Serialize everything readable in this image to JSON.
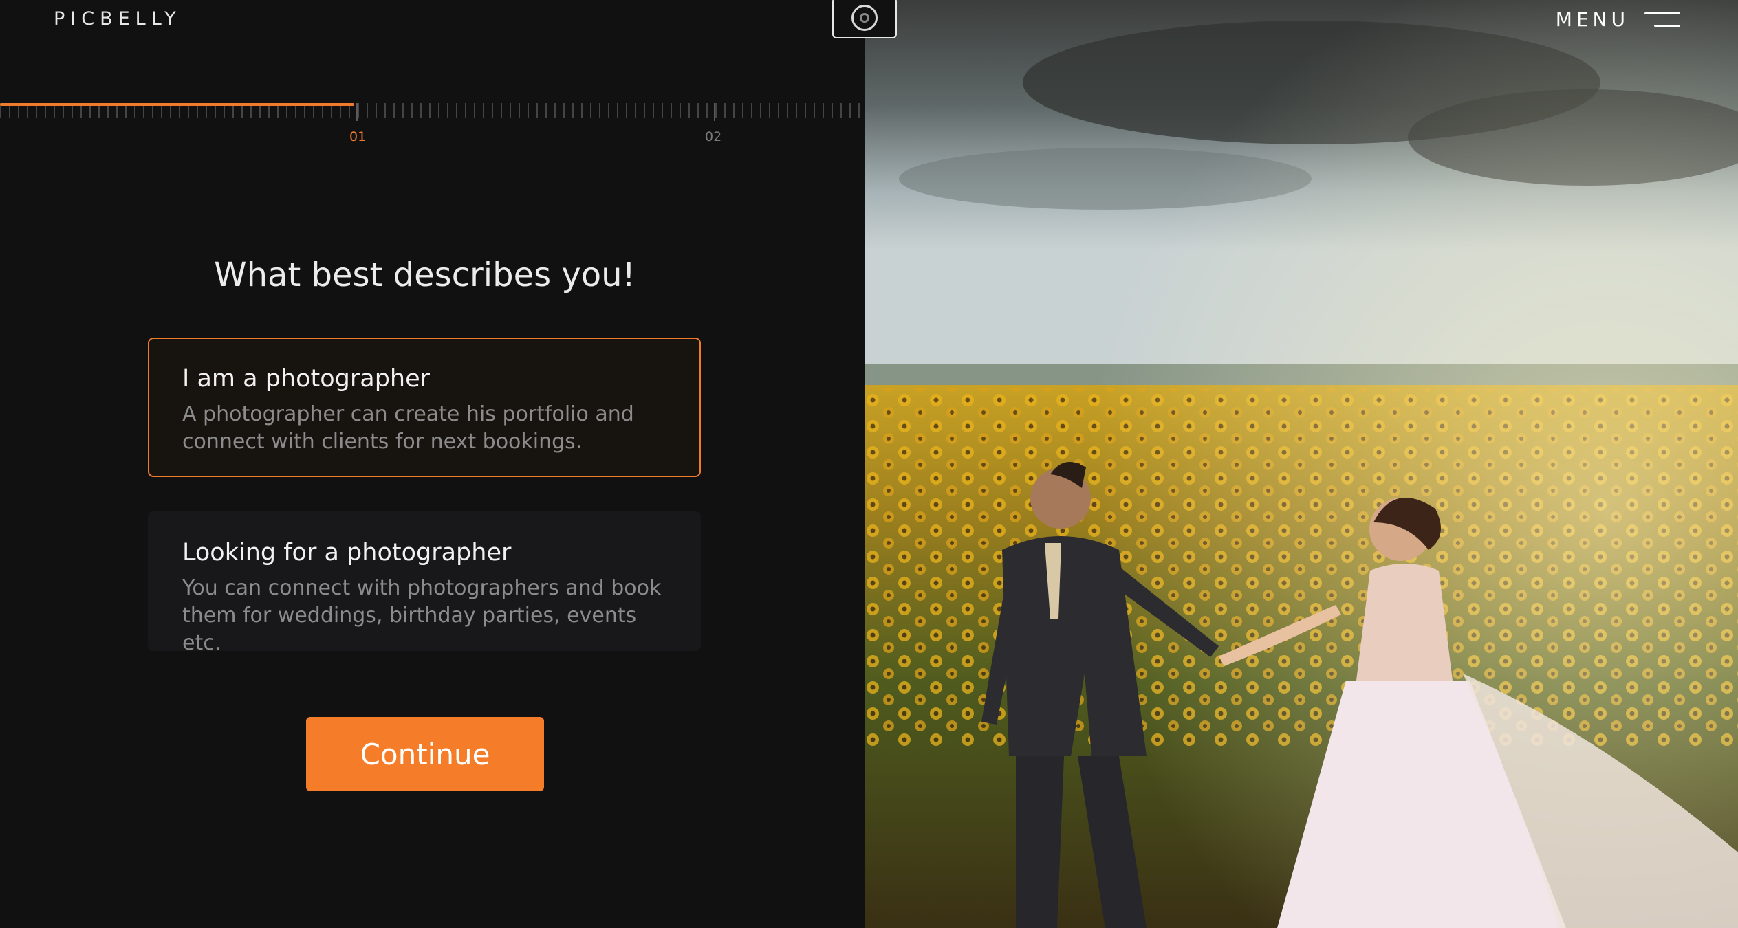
{
  "brand": {
    "name": "PICBELLY"
  },
  "header": {
    "menu_label": "MENU",
    "menu_icon": "hamburger-icon",
    "camera_icon": "camera-icon"
  },
  "progress": {
    "steps": [
      "01",
      "02"
    ],
    "active_step": 1,
    "fill_fraction": 0.41
  },
  "question": {
    "title": "What best describes you!"
  },
  "options": [
    {
      "title": "I am a photographer",
      "description": "A photographer can create his portfolio and\nconnect with clients for next bookings.",
      "selected": true
    },
    {
      "title": "Looking for a photographer",
      "description": "You can connect with photographers and book\nthem for weddings, birthday parties, events etc.",
      "selected": false
    }
  ],
  "actions": {
    "continue_label": "Continue"
  },
  "colors": {
    "accent": "#f57d29",
    "background": "#111112",
    "card_bg": "#18181a",
    "muted_text": "#8c8c8c"
  }
}
